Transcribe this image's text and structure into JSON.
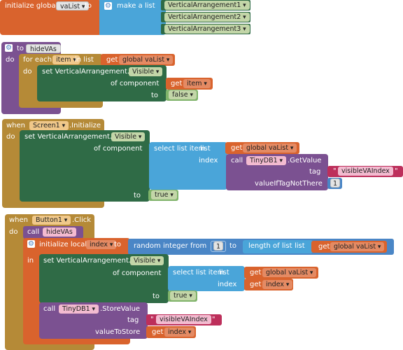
{
  "colors": {
    "variable": "#d9632d",
    "list": "#4aa5d9",
    "procedure": "#7b5191",
    "control": "#b58a37",
    "component_set": "#2f6b46",
    "component_get": "#8d6da3",
    "text": "#bd2f5b",
    "math": "#4a86c6",
    "logic": "#7fb36a"
  },
  "block1": {
    "initialize_global": "initialize global",
    "var_name": "vaList",
    "to": "to",
    "make_a_list": "make a list",
    "items": [
      "VerticalArrangement1",
      "VerticalArrangement2",
      "VerticalArrangement3"
    ]
  },
  "block2": {
    "to": "to",
    "proc_name": "hideVAs",
    "do": "do",
    "for_each": "for each",
    "item_var": "item",
    "in_list": "in list",
    "get": "get",
    "global_var": "global vaList",
    "do2": "do",
    "set_label": "set VerticalArrangement.",
    "property": "Visible",
    "of_component": "of component",
    "get2": "get",
    "item_ref": "item",
    "to2": "to",
    "false_val": "false"
  },
  "block3": {
    "when": "when",
    "component": "Screen1",
    "event": ".Initialize",
    "do": "do",
    "set_label": "set VerticalArrangement.",
    "property": "Visible",
    "of_component": "of component",
    "select_list_item": "select list item",
    "list": "list",
    "get": "get",
    "global_var": "global vaList",
    "index": "index",
    "call": "call",
    "db": "TinyDB1",
    "get_value": ".GetValue",
    "tag": "tag",
    "tag_value": "visibleVAIndex",
    "value_if_tag_not_there": "valueIfTagNotThere",
    "default_num": "1",
    "to": "to",
    "true_val": "true"
  },
  "block4": {
    "when": "when",
    "component": "Button1",
    "event": ".Click",
    "do": "do",
    "call": "call",
    "proc_name": "hideVAs",
    "initialize_local": "initialize local",
    "local_var": "index",
    "to": "to",
    "random_integer_from": "random integer from",
    "from_num": "1",
    "to2": "to",
    "length_of_list": "length of list",
    "list": "list",
    "get": "get",
    "global_var": "global vaList",
    "in": "in",
    "set_label": "set VerticalArrangement.",
    "property": "Visible",
    "of_component": "of component",
    "select_list_item": "select list item",
    "list2": "list",
    "get2": "get",
    "global_var2": "global vaList",
    "index": "index",
    "get3": "get",
    "index_ref": "index",
    "to3": "to",
    "true_val": "true",
    "call2": "call",
    "db": "TinyDB1",
    "store_value": ".StoreValue",
    "tag": "tag",
    "tag_value": "visibleVAIndex",
    "value_to_store": "valueToStore",
    "get4": "get",
    "index_ref2": "index"
  }
}
